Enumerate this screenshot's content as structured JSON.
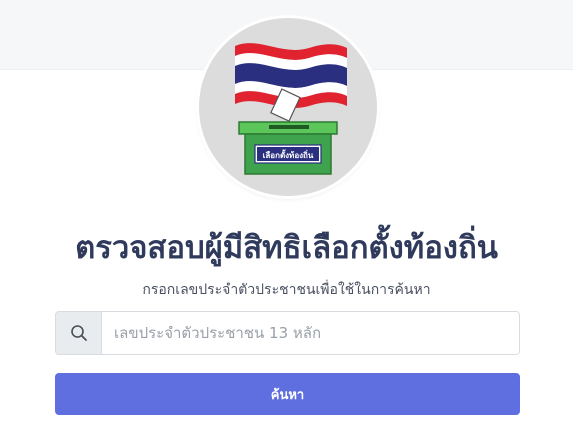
{
  "header": {
    "logo_icon": "thai-flag-ballot-box-icon",
    "ballot_box_label": "เลือกตั้งท้องถิ่น"
  },
  "main": {
    "title": "ตรวจสอบผู้มีสิทธิเลือกตั้งท้องถิ่น",
    "subtitle": "กรอกเลขประจำตัวประชาชนเพื่อใช้ในการค้นหา"
  },
  "search": {
    "icon": "search-icon",
    "placeholder": "เลขประจำตัวประชาชน 13 หลัก",
    "value": "",
    "button_label": "ค้นหา"
  },
  "colors": {
    "title": "#2f3a5c",
    "button": "#5f6fe0",
    "flag_red": "#e0232e",
    "flag_blue": "#2a2f7f",
    "ballot_green": "#3fa34d"
  }
}
